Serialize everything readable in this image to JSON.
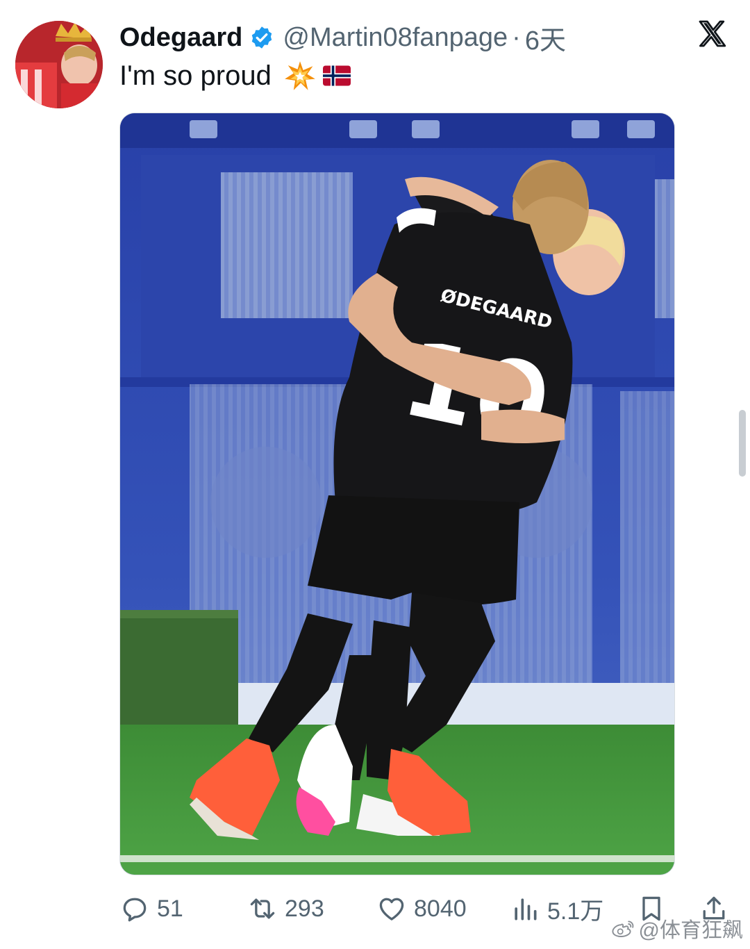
{
  "tweet": {
    "display_name": "Odegaard",
    "handle": "@Martin08fanpage",
    "separator": "·",
    "time": "6天",
    "text": "I'm so proud",
    "emojis": [
      "collision-emoji",
      "norway-flag-emoji"
    ],
    "verified": true
  },
  "media": {
    "jersey_name": "ØDEGAARD",
    "jersey_number": "10",
    "subject": "two-footballers-embracing-photo"
  },
  "actions": {
    "replies": "51",
    "retweets": "293",
    "likes": "8040",
    "views": "5.1万"
  },
  "watermark": {
    "text": "@体育狂飙"
  },
  "icons": {
    "reply": "reply-icon",
    "retweet": "retweet-icon",
    "like": "heart-icon",
    "views": "views-icon",
    "bookmark": "bookmark-icon",
    "share": "share-icon",
    "platform": "x-logo-icon"
  },
  "colors": {
    "verified_blue": "#1d9bf0",
    "secondary_text": "#536471",
    "stadium_blue": "#2b3fa8",
    "pitch_green": "#3f8f3a"
  }
}
